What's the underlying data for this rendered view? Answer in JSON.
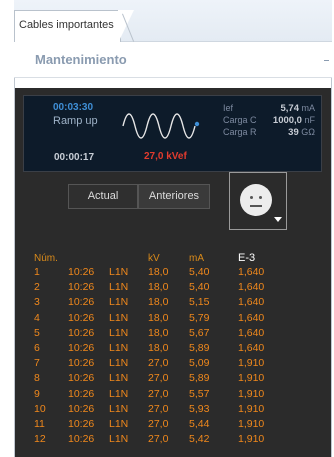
{
  "tab": {
    "label": "Cables importantes"
  },
  "panel": {
    "title": "Mantenimiento"
  },
  "status": {
    "elapsed": "00:03:30",
    "stage": "Ramp up",
    "total_time": "00:00:17",
    "voltage": "27,0 kVef",
    "measurements": [
      {
        "label": "Ief",
        "value": "5,74",
        "unit": "mA"
      },
      {
        "label": "Carga C",
        "value": "1000,0",
        "unit": "nF"
      },
      {
        "label": "Carga R",
        "value": "39",
        "unit": "GΩ"
      }
    ],
    "colors": {
      "elapsed": "#3f8fd6",
      "voltage": "#e23b2e",
      "rows": "#f0881c"
    }
  },
  "toggle": {
    "actual": "Actual",
    "previous": "Anteriores"
  },
  "face_icon": "neutral-face-icon",
  "table": {
    "headers": {
      "num": "Núm.",
      "kv": "kV",
      "ma": "mA",
      "e3": "E-3"
    },
    "rows": [
      [
        "1",
        "10:26",
        "L1N",
        "18,0",
        "5,40",
        "1,640"
      ],
      [
        "2",
        "10:26",
        "L1N",
        "18,0",
        "5,40",
        "1,640"
      ],
      [
        "3",
        "10:26",
        "L1N",
        "18,0",
        "5,15",
        "1,640"
      ],
      [
        "4",
        "10:26",
        "L1N",
        "18,0",
        "5,79",
        "1,640"
      ],
      [
        "5",
        "10:26",
        "L1N",
        "18,0",
        "5,67",
        "1,640"
      ],
      [
        "6",
        "10:26",
        "L1N",
        "18,0",
        "5,89",
        "1,640"
      ],
      [
        "7",
        "10:26",
        "L1N",
        "27,0",
        "5,09",
        "1,910"
      ],
      [
        "8",
        "10:26",
        "L1N",
        "27,0",
        "5,89",
        "1,910"
      ],
      [
        "9",
        "10:26",
        "L1N",
        "27,0",
        "5,57",
        "1,910"
      ],
      [
        "10",
        "10:26",
        "L1N",
        "27,0",
        "5,93",
        "1,910"
      ],
      [
        "11",
        "10:26",
        "L1N",
        "27,0",
        "5,44",
        "1,910"
      ],
      [
        "12",
        "10:26",
        "L1N",
        "27,0",
        "5,42",
        "1,910"
      ]
    ]
  }
}
